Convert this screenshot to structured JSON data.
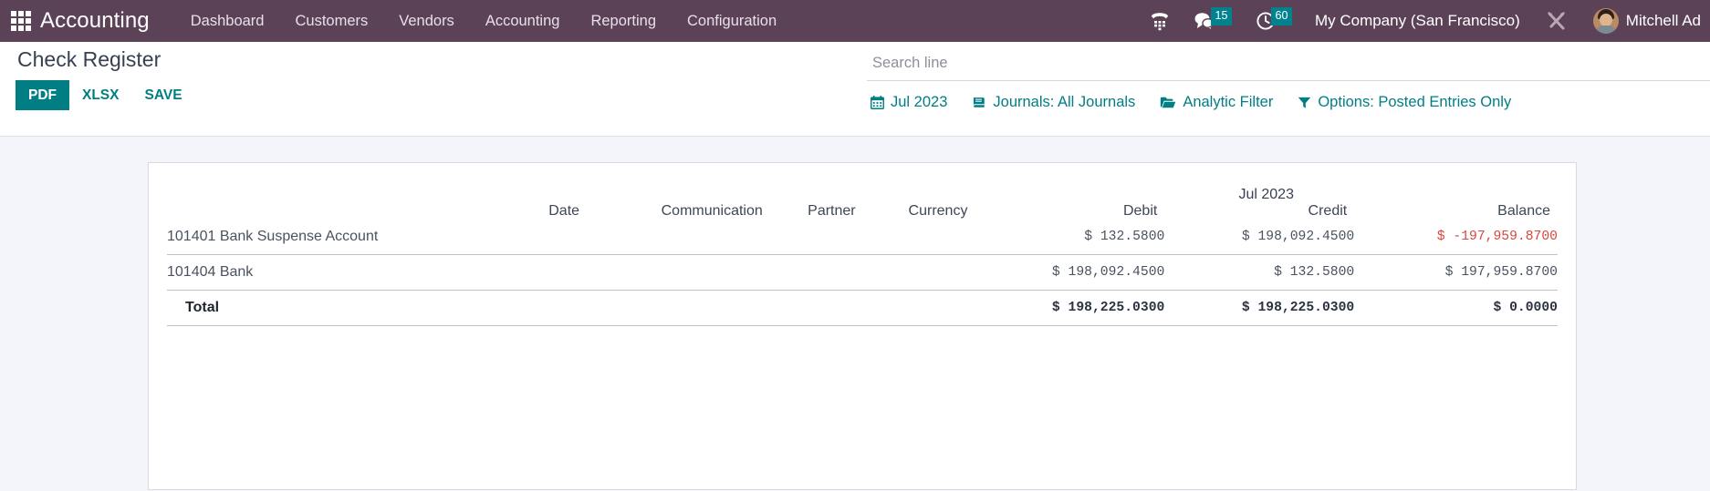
{
  "navbar": {
    "apps_icon": "apps-grid-icon",
    "brand": "Accounting",
    "menu": [
      {
        "label": "Dashboard"
      },
      {
        "label": "Customers"
      },
      {
        "label": "Vendors"
      },
      {
        "label": "Accounting"
      },
      {
        "label": "Reporting"
      },
      {
        "label": "Configuration"
      }
    ],
    "systray": {
      "phone_icon": "phone-dialpad-icon",
      "messages_icon": "chat-bubble-icon",
      "messages_count": "15",
      "activities_icon": "clock-icon",
      "activities_count": "60",
      "company": "My Company (San Francisco)",
      "tools_icon": "wrench-screwdriver-icon",
      "avatar": "user-avatar",
      "user": "Mitchell Ad"
    }
  },
  "control_panel": {
    "title": "Check Register",
    "buttons": [
      {
        "label": "PDF",
        "style": "primary",
        "name": "export-pdf-button"
      },
      {
        "label": "XLSX",
        "style": "flat",
        "name": "export-xlsx-button"
      },
      {
        "label": "SAVE",
        "style": "flat",
        "name": "save-button"
      }
    ],
    "search": {
      "placeholder": "Search line",
      "value": ""
    },
    "filters": [
      {
        "label": "Jul 2023",
        "icon": "calendar-icon",
        "name": "date-filter"
      },
      {
        "label": "Journals: All Journals",
        "icon": "book-icon",
        "name": "journals-filter"
      },
      {
        "label": "Analytic Filter",
        "icon": "folder-open-icon",
        "name": "analytic-filter"
      },
      {
        "label": "Options: Posted Entries Only",
        "icon": "funnel-icon",
        "name": "options-filter"
      }
    ]
  },
  "report": {
    "period": "Jul 2023",
    "columns": [
      {
        "label": "Date",
        "align": "right"
      },
      {
        "label": "Communication",
        "align": "right"
      },
      {
        "label": "Partner",
        "align": "right"
      },
      {
        "label": "Currency",
        "align": "right"
      },
      {
        "label": "Debit",
        "align": "right"
      },
      {
        "label": "Credit",
        "align": "right"
      },
      {
        "label": "Balance",
        "align": "right"
      }
    ],
    "rows": [
      {
        "account": "101401 Bank Suspense Account",
        "date": "",
        "communication": "",
        "partner": "",
        "currency": "",
        "debit": "$ 132.5800",
        "credit": "$ 198,092.4500",
        "balance": "$ -197,959.8700",
        "balance_negative": true,
        "is_total": false
      },
      {
        "account": "101404 Bank",
        "date": "",
        "communication": "",
        "partner": "",
        "currency": "",
        "debit": "$ 198,092.4500",
        "credit": "$ 132.5800",
        "balance": "$ 197,959.8700",
        "balance_negative": false,
        "is_total": false
      },
      {
        "account": "Total",
        "date": "",
        "communication": "",
        "partner": "",
        "currency": "",
        "debit": "$ 198,225.0300",
        "credit": "$ 198,225.0300",
        "balance": "$ 0.0000",
        "balance_negative": false,
        "is_total": true
      }
    ]
  },
  "colors": {
    "navbar_bg": "#5c4257",
    "accent_teal": "#017e84",
    "badge_teal": "#00838f",
    "negative_red": "#d9463f",
    "page_bg": "#f4f5fa"
  }
}
